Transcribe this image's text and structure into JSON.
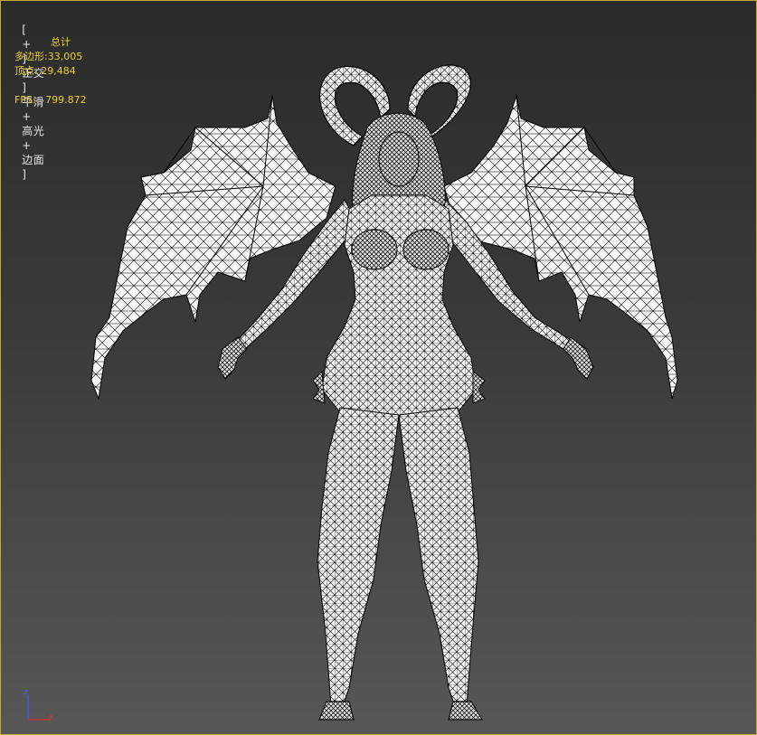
{
  "viewport": {
    "label_parts": [
      "[",
      "+",
      "]",
      "正交",
      "]",
      "平滑",
      "+",
      "高光",
      "+",
      "边面",
      "]"
    ],
    "label_display": "[ + ] 正交 ] 平滑 + 高光 + 边面 ]"
  },
  "stats": {
    "title": "总计",
    "polygons_label": "多边形:",
    "polygons_value": "33,005",
    "vertices_label": "顶点:",
    "vertices_value": "29,484",
    "fps_label": "FPS:",
    "fps_value": "799.872"
  },
  "axis_gizmo": {
    "axes": [
      "z",
      "x"
    ],
    "colors": {
      "x": "#e03030",
      "y": "#30c030",
      "z": "#4060ff"
    }
  },
  "model": {
    "render_mode": "wireframe-shaded",
    "mesh_color": "#f4f4f4",
    "wire_color": "#000000"
  },
  "colors": {
    "frame_border": "#c8a832",
    "stats_text": "#f0cf3a",
    "label_text": "#e6e6e6"
  }
}
